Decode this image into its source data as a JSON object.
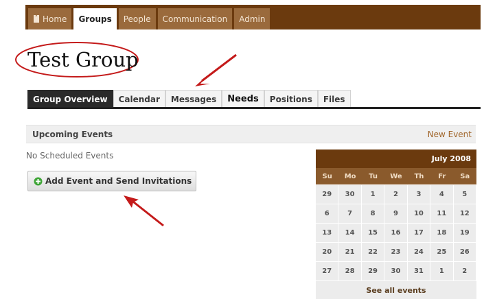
{
  "nav": {
    "tabs": [
      {
        "label": "Home",
        "icon": "home-icon"
      },
      {
        "label": "Groups"
      },
      {
        "label": "People"
      },
      {
        "label": "Communication"
      },
      {
        "label": "Admin"
      }
    ],
    "active": "Groups"
  },
  "group": {
    "title": "Test Group"
  },
  "subtabs": [
    "Group Overview",
    "Calendar",
    "Messages",
    "Needs",
    "Positions",
    "Files"
  ],
  "events": {
    "title": "Upcoming Events",
    "new_event": "New Event",
    "empty": "No Scheduled Events",
    "add_button": "Add Event and Send Invitations"
  },
  "calendar": {
    "month": "July 2008",
    "weekdays": [
      "Su",
      "Mo",
      "Tu",
      "We",
      "Th",
      "Fr",
      "Sa"
    ],
    "weeks": [
      [
        "29",
        "30",
        "1",
        "2",
        "3",
        "4",
        "5"
      ],
      [
        "6",
        "7",
        "8",
        "9",
        "10",
        "11",
        "12"
      ],
      [
        "13",
        "14",
        "15",
        "16",
        "17",
        "18",
        "19"
      ],
      [
        "20",
        "21",
        "22",
        "23",
        "24",
        "25",
        "26"
      ],
      [
        "27",
        "28",
        "29",
        "30",
        "31",
        "1",
        "2"
      ]
    ],
    "footer": "See all events"
  },
  "colors": {
    "brand": "#6b3a0e",
    "annotation": "#c41a1a"
  }
}
